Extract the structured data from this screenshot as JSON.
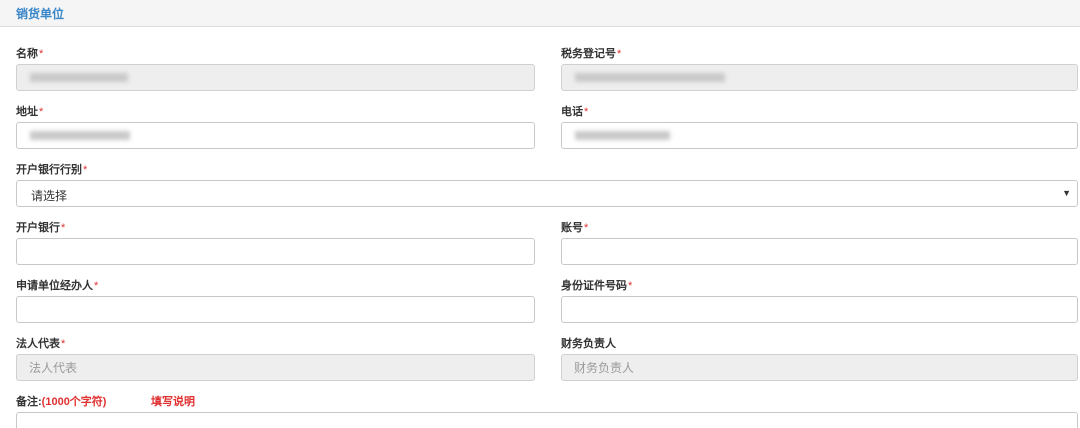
{
  "panel": {
    "title": "销货单位"
  },
  "form": {
    "required_mark": "*",
    "name": {
      "label": "名称"
    },
    "tax_no": {
      "label": "税务登记号"
    },
    "address": {
      "label": "地址"
    },
    "phone": {
      "label": "电话"
    },
    "bank_type": {
      "label": "开户银行行别",
      "selected": "请选择",
      "arrow": "▼"
    },
    "bank": {
      "label": "开户银行",
      "value": ""
    },
    "account": {
      "label": "账号",
      "value": ""
    },
    "agent": {
      "label": "申请单位经办人",
      "value": ""
    },
    "id_no": {
      "label": "身份证件号码",
      "value": ""
    },
    "legal_rep": {
      "label": "法人代表",
      "placeholder": "法人代表"
    },
    "finance_head": {
      "label": "财务负责人",
      "placeholder": "财务负责人"
    },
    "remark": {
      "label": "备注:",
      "limit": "(1000个字符)",
      "help_link": "填写说明"
    }
  }
}
